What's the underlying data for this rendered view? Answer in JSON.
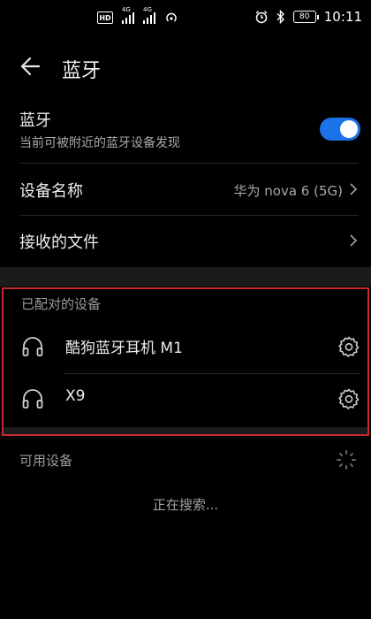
{
  "status_bar": {
    "hd_label": "HD",
    "sim1_label": "4G",
    "sim2_label": "4G",
    "battery": "80",
    "time": "10:11"
  },
  "header": {
    "title": "蓝牙"
  },
  "bluetooth": {
    "title": "蓝牙",
    "subtitle": "当前可被附近的蓝牙设备发现",
    "enabled": true
  },
  "device_name": {
    "label": "设备名称",
    "value": "华为 nova 6 (5G)"
  },
  "received_files": {
    "label": "接收的文件"
  },
  "paired": {
    "section_title": "已配对的设备",
    "devices": [
      {
        "name": "酷狗蓝牙耳机 M1"
      },
      {
        "name": "X9"
      }
    ]
  },
  "available": {
    "section_title": "可用设备",
    "status": "正在搜索..."
  },
  "colors": {
    "accent": "#1a73e8",
    "highlight_border": "#c8282c",
    "background": "#000000"
  }
}
